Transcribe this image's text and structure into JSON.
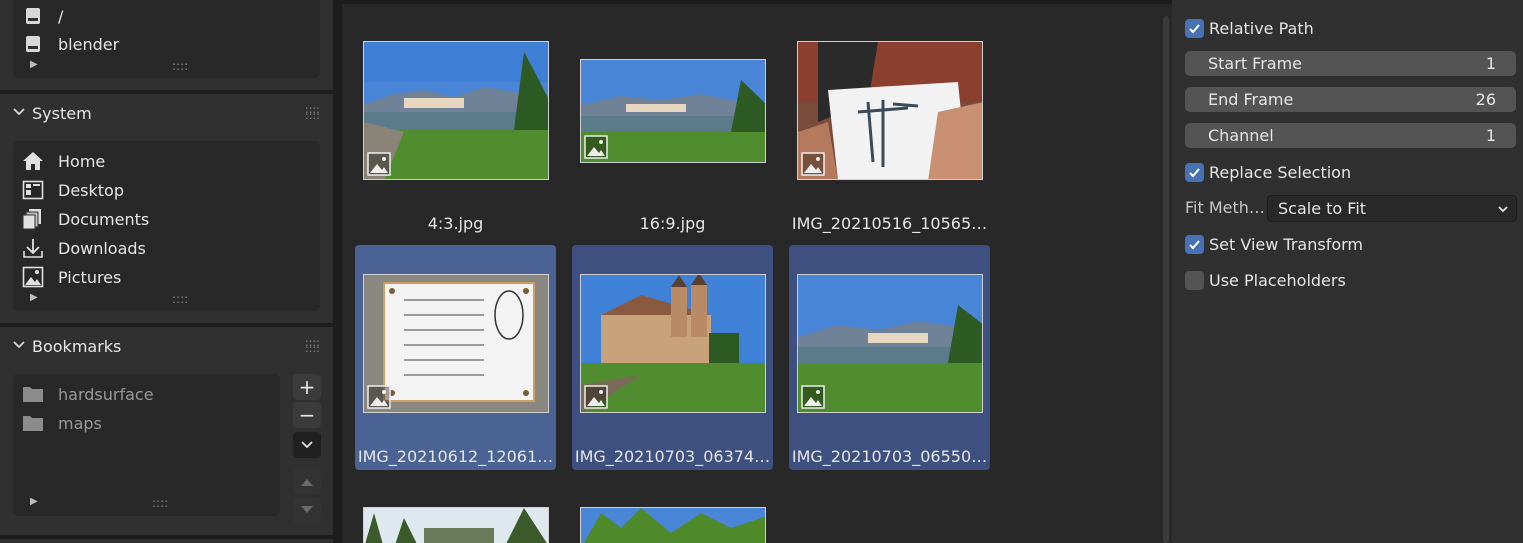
{
  "volumes": {
    "items": [
      {
        "label": "/",
        "icon": "drive-icon"
      },
      {
        "label": "blender",
        "icon": "drive-icon"
      }
    ]
  },
  "system": {
    "title": "System",
    "items": [
      {
        "label": "Home",
        "icon": "home-icon"
      },
      {
        "label": "Desktop",
        "icon": "desktop-icon"
      },
      {
        "label": "Documents",
        "icon": "documents-icon"
      },
      {
        "label": "Downloads",
        "icon": "download-icon"
      },
      {
        "label": "Pictures",
        "icon": "image-icon"
      }
    ]
  },
  "bookmarks": {
    "title": "Bookmarks",
    "items": [
      {
        "label": "hardsurface",
        "icon": "folder-icon"
      },
      {
        "label": "maps",
        "icon": "folder-icon"
      }
    ],
    "add_symbol": "+",
    "remove_symbol": "−"
  },
  "files": [
    {
      "name": "4:3.jpg",
      "selected": false
    },
    {
      "name": "16:9.jpg",
      "selected": false
    },
    {
      "name": "IMG_20210516_10565…",
      "selected": false
    },
    {
      "name": "IMG_20210612_12061…",
      "selected": true,
      "active": true
    },
    {
      "name": "IMG_20210703_06374…",
      "selected": true
    },
    {
      "name": "IMG_20210703_06550…",
      "selected": true
    }
  ],
  "options": {
    "relative_path": {
      "label": "Relative Path",
      "checked": true
    },
    "start_frame": {
      "label": "Start Frame",
      "value": "1"
    },
    "end_frame": {
      "label": "End Frame",
      "value": "26"
    },
    "channel": {
      "label": "Channel",
      "value": "1"
    },
    "replace_selection": {
      "label": "Replace Selection",
      "checked": true
    },
    "fit_method": {
      "label": "Fit Meth…",
      "value": "Scale to Fit"
    },
    "set_view_transform": {
      "label": "Set View Transform",
      "checked": true
    },
    "use_placeholders": {
      "label": "Use Placeholders",
      "checked": false
    }
  },
  "colors": {
    "accent": "#4772b3",
    "selected_tile": "#3d5080",
    "panel_bg": "#303030",
    "browser_bg": "#282828"
  }
}
